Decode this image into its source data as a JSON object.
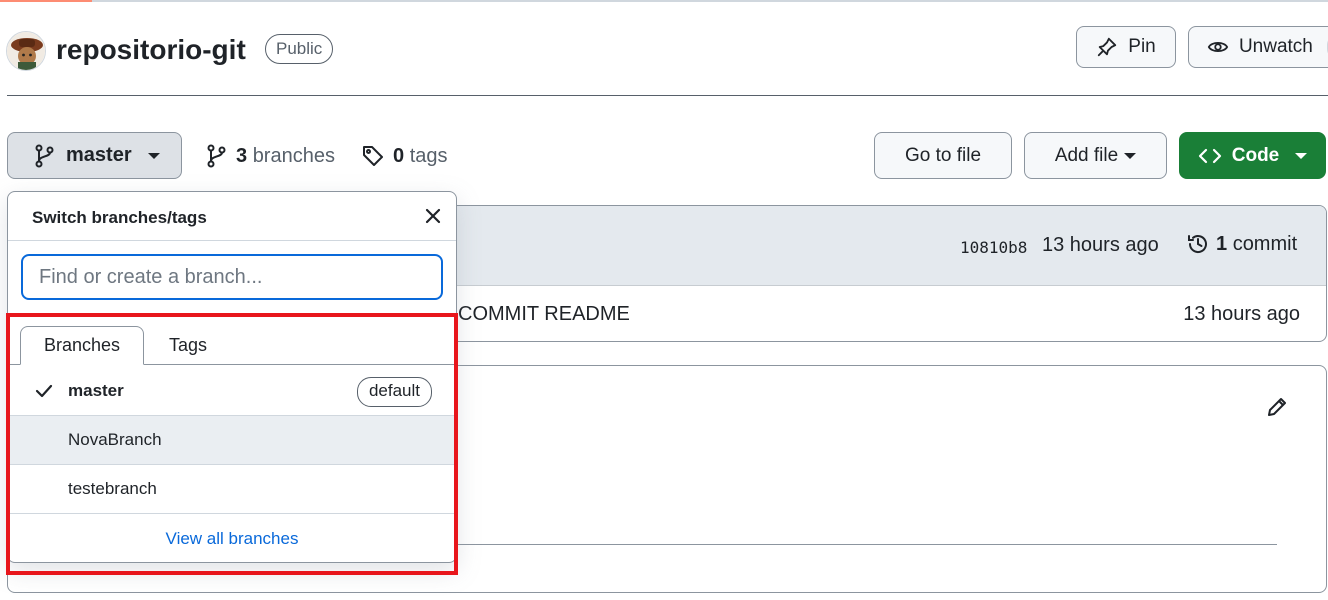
{
  "header": {
    "repo_name": "repositorio-git",
    "visibility": "Public",
    "pin_label": "Pin",
    "watch_label": "Unwatch"
  },
  "toolbar": {
    "branch": "master",
    "branches_count": "3",
    "branches_label": "branches",
    "tags_count": "0",
    "tags_label": "tags",
    "go_to_file": "Go to file",
    "add_file": "Add file",
    "code": "Code"
  },
  "commit": {
    "sha": "10810b8",
    "time": "13 hours ago",
    "count": "1",
    "count_label": "commit"
  },
  "file_row": {
    "message": "COMMIT README",
    "time": "13 hours ago"
  },
  "dropdown": {
    "title": "Switch branches/tags",
    "placeholder": "Find or create a branch...",
    "tabs": [
      "Branches",
      "Tags"
    ],
    "branches": [
      {
        "name": "master",
        "badge": "default",
        "selected": true
      },
      {
        "name": "NovaBranch"
      },
      {
        "name": "testebranch"
      }
    ],
    "view_all": "View all branches"
  },
  "colors": {
    "accent_blue": "#0969da",
    "code_green": "#1a7f37",
    "highlight_red": "#e8161c"
  }
}
